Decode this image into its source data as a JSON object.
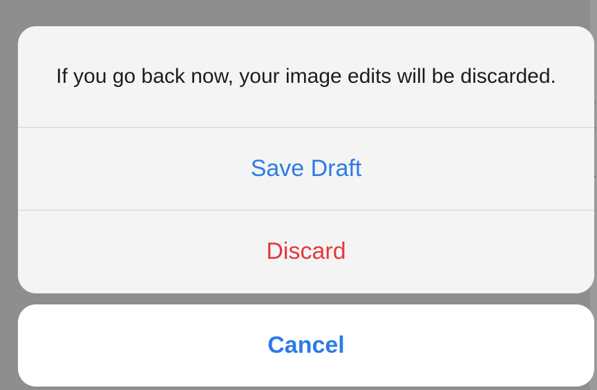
{
  "alert": {
    "message": "If you go back now, your image edits will be discarded.",
    "save_draft_label": "Save Draft",
    "discard_label": "Discard",
    "cancel_label": "Cancel"
  },
  "colors": {
    "action_blue": "#2c7be5",
    "destructive_red": "#e5393a",
    "overlay": "#8e8e8f"
  }
}
